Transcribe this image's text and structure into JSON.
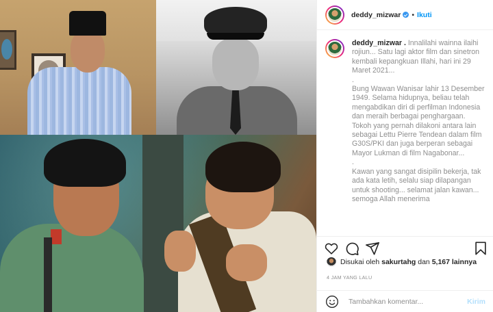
{
  "post": {
    "username": "deddy_mizwar",
    "header_separator": "•",
    "follow_label": "Ikuti"
  },
  "caption": {
    "username": "deddy_mizwar .",
    "text": "Innalilahi wainna ilaihi rojiun... Satu lagi aktor film dan sinetron kembali kepangkuan Illahi, hari ini 29 Maret 2021...\n.\nBung Wawan Wanisar lahir 13 Desember 1949. Selama hidupnya, beliau telah mengabdikan diri di perfilman Indonesia dan meraih berbagai penghargaan. Tokoh yang pernah dilakoni antara lain sebagai Lettu Pierre Tendean dalam film G30S/PKI dan juga berperan sebagai Mayor Lukman di film Nagabonar...\n.\nKawan yang sangat disipilin bekerja, tak ada kata letih, selalu siap dilapangan untuk shooting... selamat jalan kawan... semoga Allah menerima"
  },
  "likes": {
    "prefix": "Disukai oleh",
    "user": "sakurtahg",
    "and": "dan",
    "count": "5,167 lainnya"
  },
  "timestamp": "4 JAM YANG LALU",
  "comment": {
    "placeholder": "Tambahkan komentar...",
    "post_label": "Kirim"
  },
  "icons": {
    "like": "heart-icon",
    "comment": "comment-icon",
    "share": "share-icon",
    "save": "bookmark-icon",
    "emoji": "smiley-icon",
    "verified": "verified-badge-icon"
  },
  "colors": {
    "link_blue": "#0095f6",
    "muted_text": "#8e8e8e",
    "post_button_disabled": "#b2dffc"
  }
}
